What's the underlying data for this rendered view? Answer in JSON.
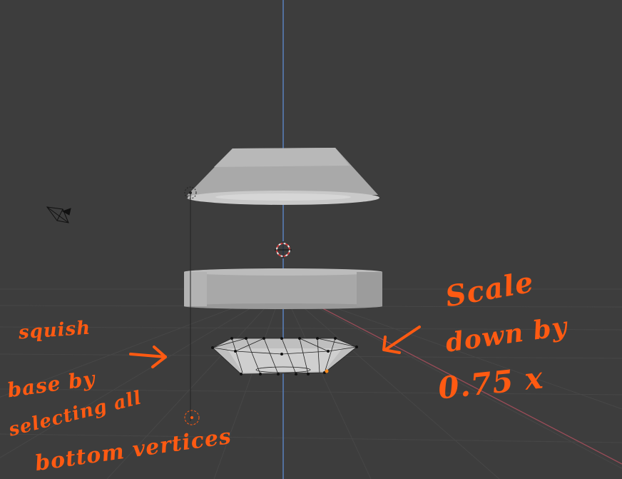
{
  "app": {
    "name": "3D viewport"
  },
  "colors": {
    "background": "#3d3d3d",
    "grid": "#4a4a4a",
    "z_axis": "#5b86c7",
    "x_axis": "#9a4c58",
    "mesh": "#a9a9a9",
    "annotation": "#ff5a12"
  },
  "objects": [
    "camera",
    "cone-top",
    "cylinder-ring",
    "squished-base",
    "3d-cursor",
    "light"
  ],
  "annotations": {
    "left_lines": [
      "squish",
      "base by",
      "selecting all",
      "bottom vertices"
    ],
    "right_lines": [
      "Scale",
      "down by",
      "0.75 x"
    ]
  }
}
